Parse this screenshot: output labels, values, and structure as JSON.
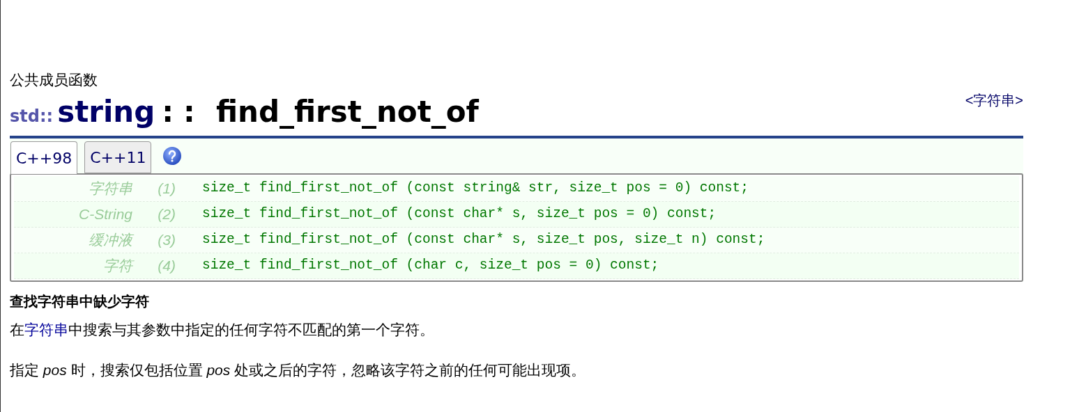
{
  "category": "公共成员函数",
  "title": {
    "namespace": "std::",
    "class": "string",
    "separator": "::",
    "name": "find_first_not_of"
  },
  "header_link": "<字符串>",
  "tabs": [
    {
      "label": "C++98",
      "selected": true
    },
    {
      "label": "C++11",
      "selected": false
    }
  ],
  "overloads": [
    {
      "label": "字符串",
      "number": "(1)",
      "code": "size_t find_first_not_of (const string& str, size_t pos = 0) const;"
    },
    {
      "label": "C-String",
      "number": "(2)",
      "code": "size_t find_first_not_of (const char* s, size_t pos = 0) const;"
    },
    {
      "label": "缓冲液",
      "number": "(3)",
      "code": "size_t find_first_not_of (const char* s, size_t pos, size_t n) const;"
    },
    {
      "label": "字符",
      "number": "(4)",
      "code": "size_t find_first_not_of (char c, size_t pos = 0) const;"
    }
  ],
  "summary": "查找字符串中缺少字符",
  "description": {
    "before": "在",
    "link": "字符串",
    "after": "中搜索与其参数中指定的任何字符不匹配的第一个字符。"
  },
  "note": "指定 *pos* 时，搜索仅包括位置 *pos* 处或之后的字符，忽略该字符之前的任何可能出现项。"
}
